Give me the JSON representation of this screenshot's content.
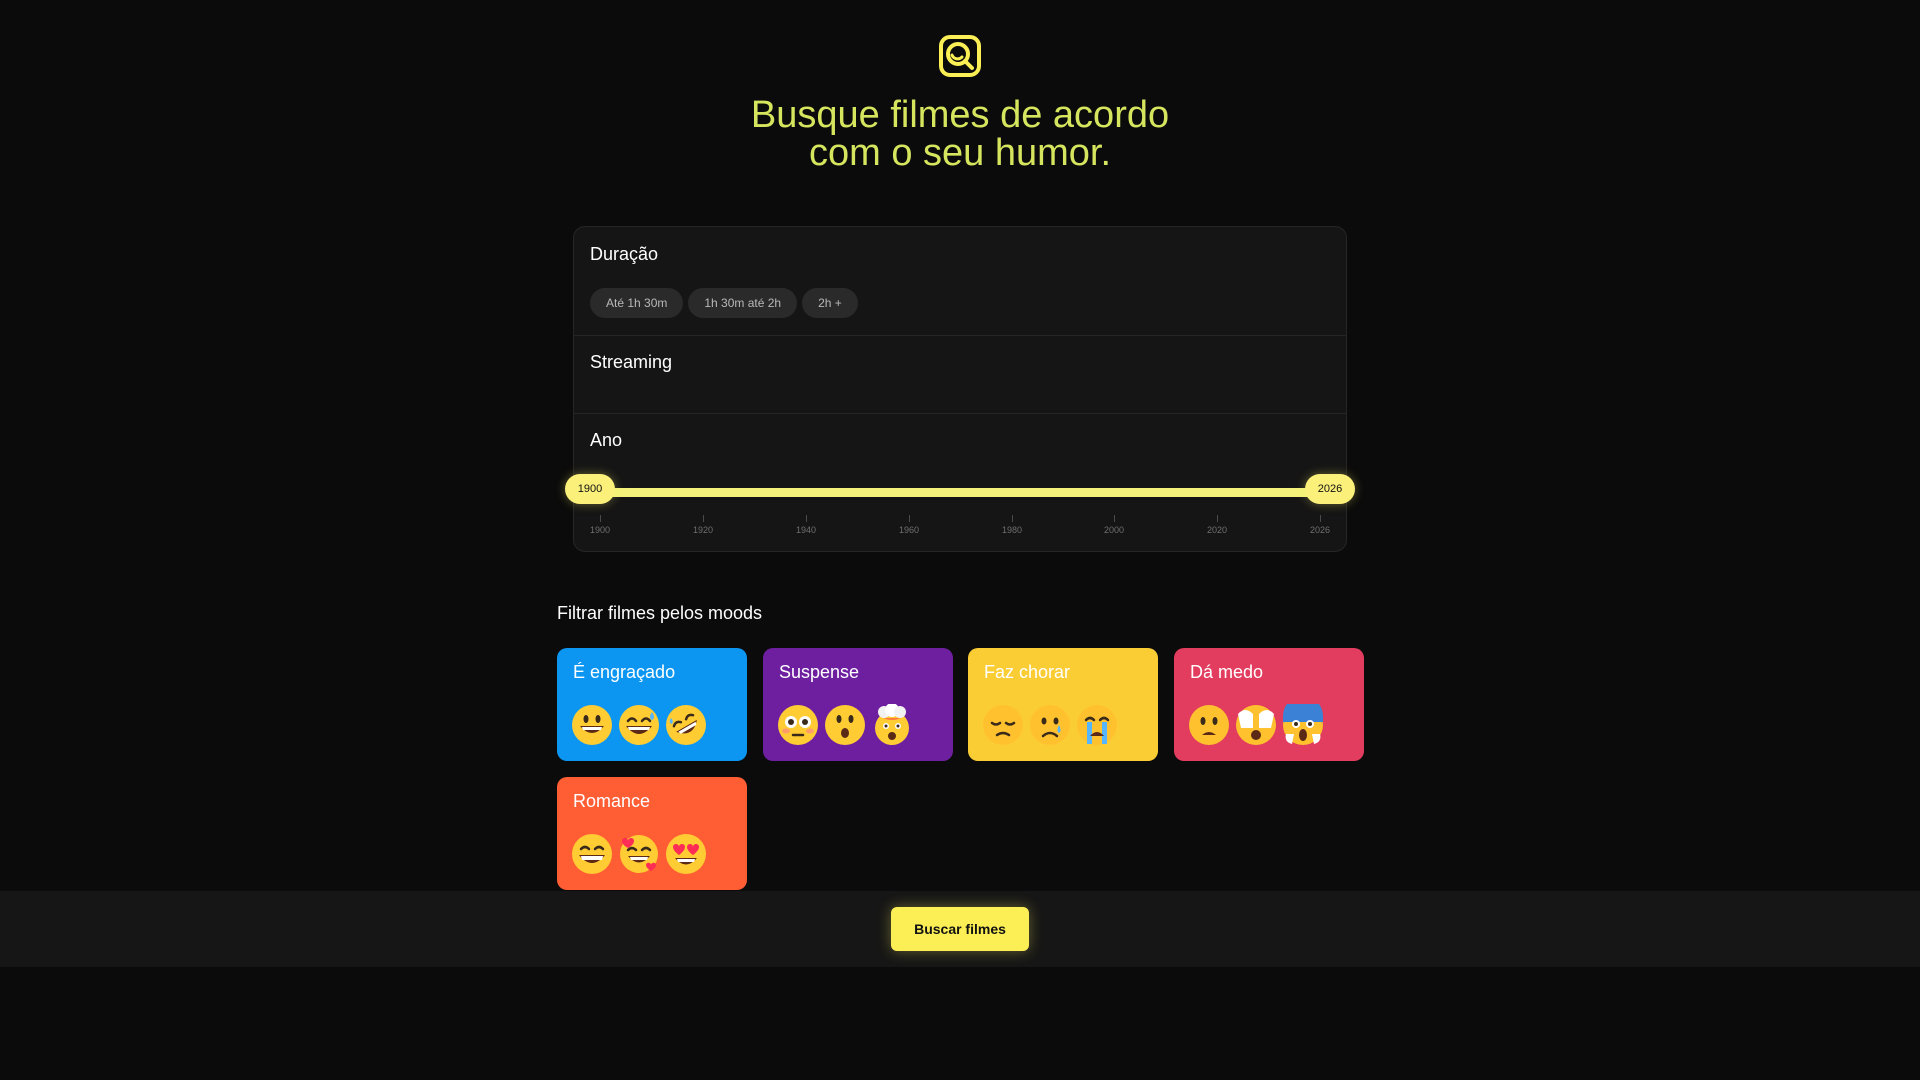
{
  "app": {
    "logo_icon": "search-emoji-icon",
    "brand_color": "#d6e55e",
    "title_line1": "Busque filmes de acordo",
    "title_line2": "com o seu humor."
  },
  "filters": {
    "duration": {
      "title": "Duração",
      "options": [
        "Até 1h 30m",
        "1h 30m até 2h",
        "2h +"
      ]
    },
    "streaming": {
      "title": "Streaming"
    },
    "year": {
      "title": "Ano",
      "min_value": "1900",
      "max_value": "2026",
      "range_min": 1900,
      "range_max": 2026,
      "ticks": [
        "1900",
        "1920",
        "1940",
        "1960",
        "1980",
        "2000",
        "2020",
        "2026"
      ]
    }
  },
  "moods": {
    "heading": "Filtrar filmes pelos moods",
    "cards": [
      {
        "label": "É engraçado",
        "color": "#0c96f2",
        "emojis": [
          "grinning-face-icon",
          "grin-sweat-icon",
          "rofl-icon"
        ]
      },
      {
        "label": "Suspense",
        "color": "#6e1fa0",
        "emojis": [
          "flushed-face-icon",
          "hushed-face-icon",
          "exploding-head-icon"
        ]
      },
      {
        "label": "Faz chorar",
        "color": "#fbcd34",
        "emojis": [
          "pensive-face-icon",
          "sad-tear-face-icon",
          "loudly-crying-face-icon"
        ]
      },
      {
        "label": "Dá medo",
        "color": "#e23c5f",
        "emojis": [
          "frowning-face-icon",
          "face-hands-over-eyes-icon",
          "screaming-face-icon"
        ]
      },
      {
        "label": "Romance",
        "color": "#ff5d34",
        "emojis": [
          "beaming-face-icon",
          "smiling-hearts-icon",
          "heart-eyes-icon"
        ]
      }
    ]
  },
  "actions": {
    "search_label": "Buscar filmes",
    "accent": "#fbef55"
  }
}
